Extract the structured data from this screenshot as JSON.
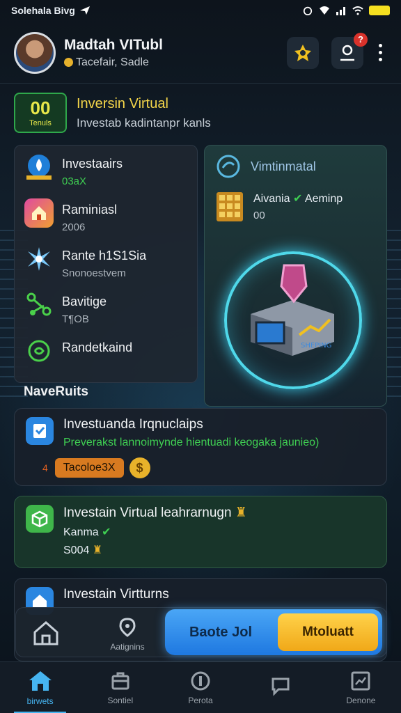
{
  "status_bar": {
    "title": "Solehala Bivg"
  },
  "header": {
    "name": "Madtah VITubl",
    "subtitle": "Tacefair, Sadle",
    "notification_badge": "?"
  },
  "banner": {
    "score_value": "00",
    "score_label": "Tenuls",
    "title": "Inversin Virtual",
    "subtitle": "Investab kadintanpr kanls"
  },
  "menu": [
    {
      "title": "Investaairs",
      "sub": "03aX",
      "icon": "drop-icon"
    },
    {
      "title": "Raminiasl",
      "sub": "2006",
      "icon": "house-icon"
    },
    {
      "title": "Rante h1S1Sia",
      "sub": "Snonoestvem",
      "icon": "star-burst-icon"
    },
    {
      "title": "Bavitige",
      "sub": "T¶OB",
      "icon": "nodes-icon"
    },
    {
      "title": "Randetkaind",
      "sub": "",
      "icon": "swirl-icon"
    }
  ],
  "promo": {
    "title": "Vimtinmatal",
    "row_a": "Aivania",
    "row_a_tail": "Aeminp",
    "row_b": "00",
    "device_label": "SHEPING"
  },
  "section_title": "NaveRuits",
  "cards": [
    {
      "title": "Investuanda Irqnuclaips",
      "sub": "Preverakst lannoimynde hientuadi keogaka jaunieo)",
      "number": "4",
      "pill": "Tacoloe3X",
      "dollar": "$"
    },
    {
      "title": "Investain Virtual leahrarnugn",
      "line2": "Kanma",
      "line3": "S004"
    },
    {
      "title": "Investain Virtturns"
    }
  ],
  "action_bar": {
    "pin_label": "Aatignins",
    "primary_label": "Baote Jol",
    "secondary_label": "Mtoluatt"
  },
  "bottom_nav": [
    {
      "label": "birwets",
      "active": true
    },
    {
      "label": "Sontiel"
    },
    {
      "label": "Perota"
    },
    {
      "label": ""
    },
    {
      "label": "Denone"
    }
  ],
  "colors": {
    "accent_blue": "#46b4f0",
    "accent_yellow": "#f5d64a",
    "accent_green": "#3fcf52",
    "badge_red": "#d9322b"
  }
}
